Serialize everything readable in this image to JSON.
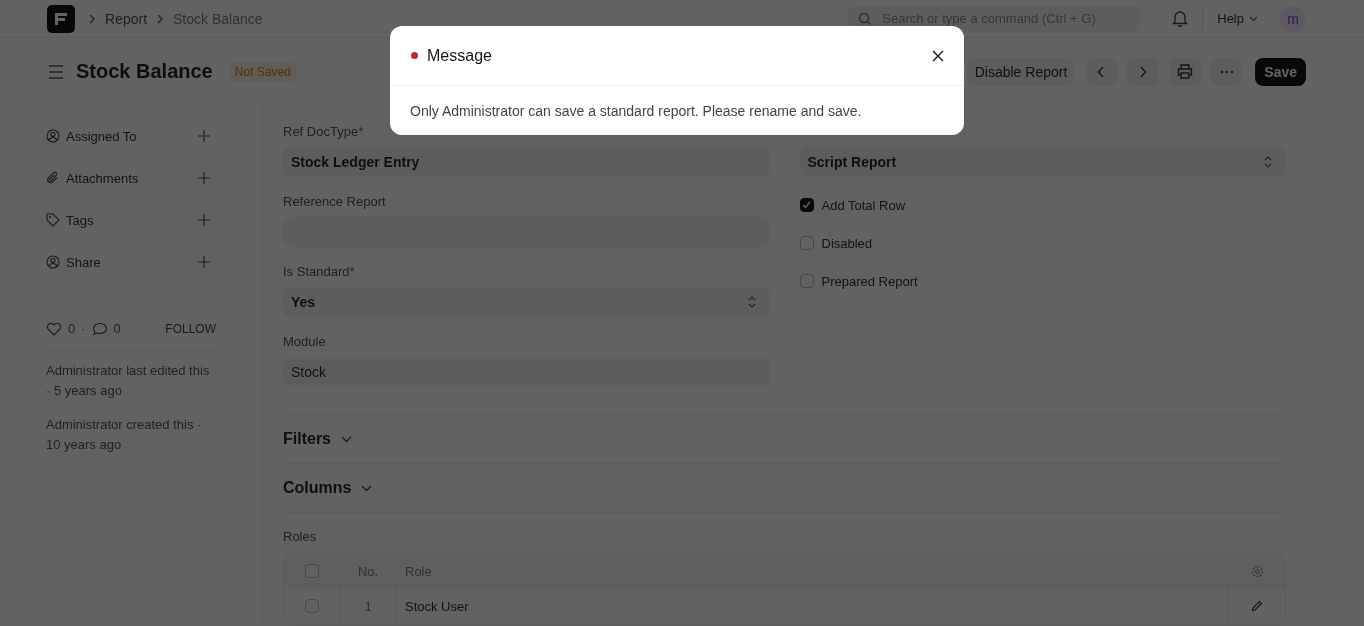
{
  "navbar": {
    "breadcrumbs": [
      "Report",
      "Stock Balance"
    ],
    "search": {
      "placeholder": "Search or type a command (Ctrl + G)"
    },
    "help": "Help",
    "avatar": "m"
  },
  "page_head": {
    "title": "Stock Balance",
    "status": "Not Saved",
    "secondary_button": "Disable Report",
    "primary_button": "Save"
  },
  "sidebar": {
    "items": [
      {
        "label": "Assigned To",
        "kind": "assign"
      },
      {
        "label": "Attachments",
        "kind": "attach"
      },
      {
        "label": "Tags",
        "kind": "tag"
      },
      {
        "label": "Share",
        "kind": "share"
      }
    ],
    "likes": "0",
    "separator": "·",
    "comments": "0",
    "follow": "FOLLOW",
    "activity": [
      "Administrator last edited this · 5 years ago",
      "Administrator created this · 10 years ago"
    ]
  },
  "form": {
    "left": [
      {
        "label": "Ref DocType",
        "required_mark": "*",
        "kind": "link",
        "value": "Stock Ledger Entry"
      },
      {
        "label": "Reference Report",
        "kind": "data"
      },
      {
        "label": "Is Standard",
        "required_mark": "*",
        "kind": "select",
        "value": "Yes"
      },
      {
        "label": "Module",
        "kind": "data",
        "value": "Stock"
      }
    ],
    "right": {
      "kind": "select",
      "value": "Script Report"
    },
    "checks": [
      {
        "label": "Add Total Row",
        "checked": true
      },
      {
        "label": "Disabled",
        "checked": false
      },
      {
        "label": "Prepared Report",
        "checked": false
      }
    ]
  },
  "sections": [
    {
      "title": "Filters"
    },
    {
      "title": "Columns"
    }
  ],
  "roles": {
    "label": "Roles",
    "select_all": false,
    "columns": [
      "No.",
      "Role"
    ],
    "rows": [
      {
        "no": "1",
        "role": "Stock User",
        "selected": false
      }
    ]
  },
  "dialog": {
    "title": "Message",
    "color": "#c0282d",
    "message": "Only Administrator can save a standard report. Please rename and save."
  }
}
